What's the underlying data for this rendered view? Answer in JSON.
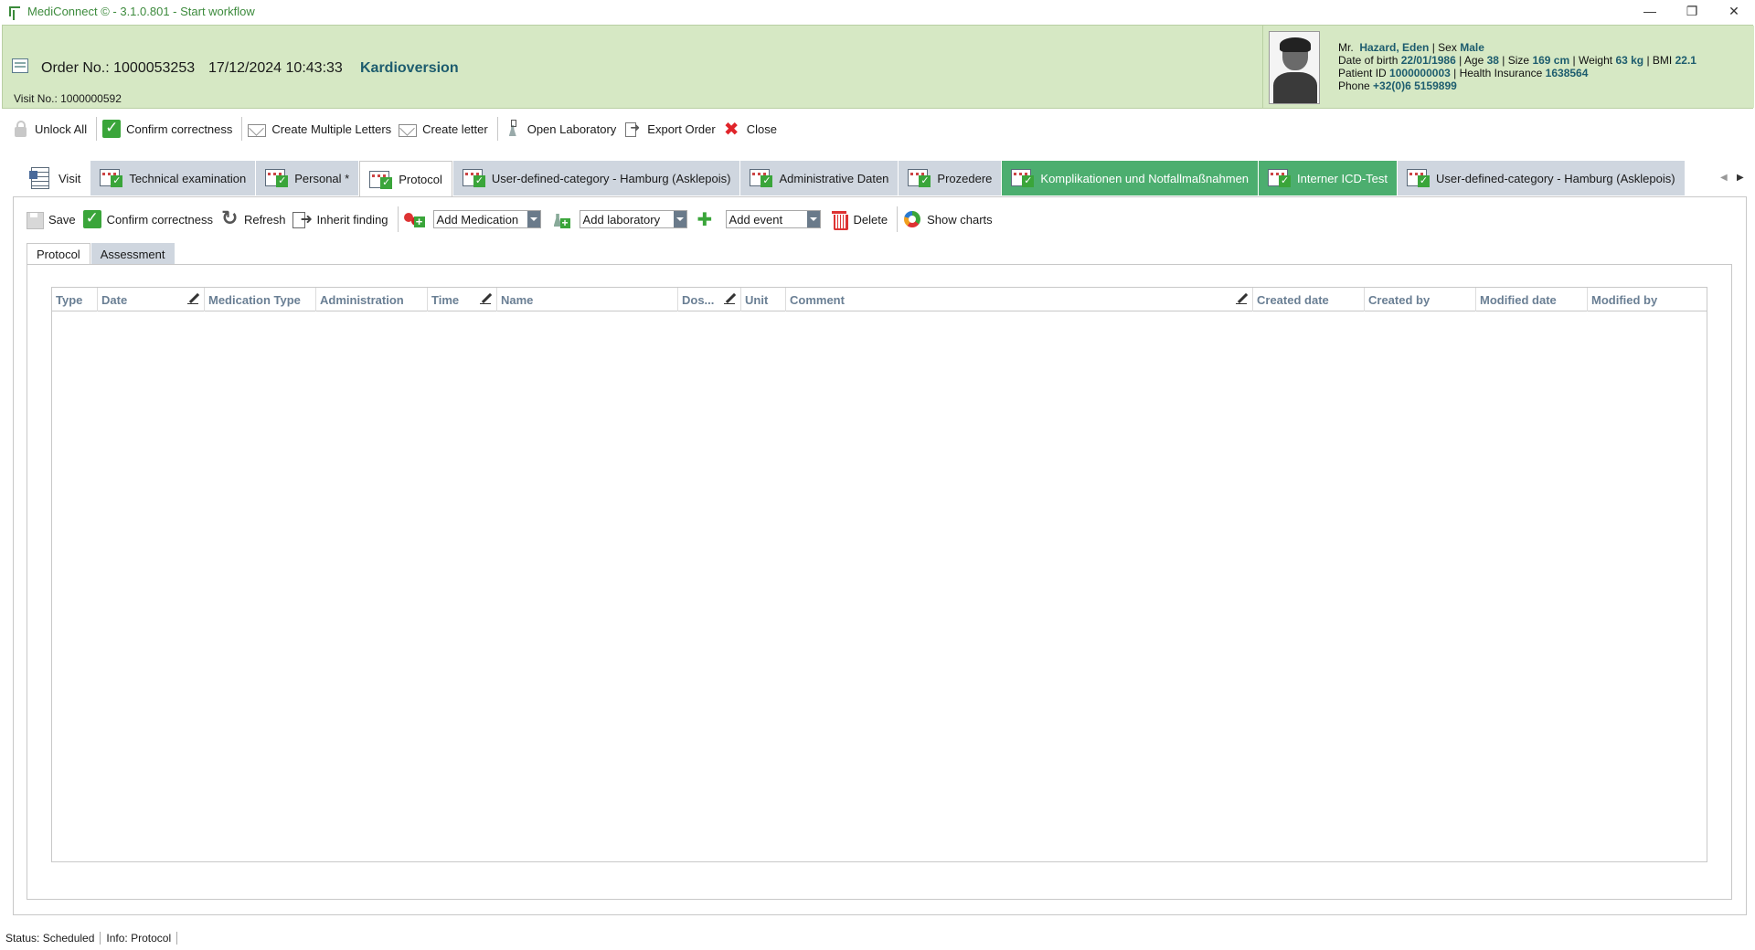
{
  "window": {
    "title": "MediConnect © - 3.1.0.801 - Start workflow",
    "controls": [
      "—",
      "❐",
      "✕"
    ]
  },
  "header": {
    "order_no": "Order No.: 1000053253",
    "order_datetime": "17/12/2024 10:43:33",
    "procedure": "Kardioversion",
    "visit_no": "Visit No.: 1000000592"
  },
  "patient": {
    "salutation": "Mr.",
    "name": "Hazard, Eden",
    "sex_label": "Sex",
    "sex": "Male",
    "dob_label": "Date of birth",
    "dob": "22/01/1986",
    "age_label": "Age",
    "age": "38",
    "size_label": "Size",
    "size": "169 cm",
    "weight_label": "Weight",
    "weight": "63 kg",
    "bmi_label": "BMI",
    "bmi": "22.1",
    "patient_id_label": "Patient ID",
    "patient_id": "1000000003",
    "insurance_label": "Health Insurance",
    "insurance": "1638564",
    "phone_label": "Phone",
    "phone": "+32(0)6 5159899"
  },
  "toolbar": {
    "unlock_all": "Unlock All",
    "confirm_correctness": "Confirm correctness",
    "create_multiple_letters": "Create Multiple Letters",
    "create_letter": "Create letter",
    "open_laboratory": "Open Laboratory",
    "export_order": "Export Order",
    "close": "Close"
  },
  "category_tabs": [
    {
      "label": "Visit",
      "state": "first"
    },
    {
      "label": "Technical examination",
      "state": "normal"
    },
    {
      "label": "Personal *",
      "state": "normal"
    },
    {
      "label": "Protocol",
      "state": "active"
    },
    {
      "label": "User-defined-category - Hamburg (Asklepois)",
      "state": "normal"
    },
    {
      "label": "Administrative Daten",
      "state": "normal"
    },
    {
      "label": "Prozedere",
      "state": "normal"
    },
    {
      "label": "Komplikationen und Notfallmaßnahmen",
      "state": "green"
    },
    {
      "label": "Interner ICD-Test",
      "state": "green"
    },
    {
      "label": "User-defined-category - Hamburg (Asklepois)",
      "state": "normal"
    }
  ],
  "sub_toolbar": {
    "save": "Save",
    "confirm_correctness": "Confirm correctness",
    "refresh": "Refresh",
    "inherit_finding": "Inherit finding",
    "add_medication": "Add Medication",
    "add_laboratory": "Add laboratory",
    "add_event": "Add event",
    "delete": "Delete",
    "show_charts": "Show charts"
  },
  "inner_tabs": {
    "protocol": "Protocol",
    "assessment": "Assessment"
  },
  "grid": {
    "columns": [
      {
        "label": "Type",
        "editable": false
      },
      {
        "label": "Date",
        "editable": true
      },
      {
        "label": "Medication Type",
        "editable": false
      },
      {
        "label": "Administration",
        "editable": false
      },
      {
        "label": "Time",
        "editable": true
      },
      {
        "label": "Name",
        "editable": false
      },
      {
        "label": "Dos...",
        "editable": true
      },
      {
        "label": "Unit",
        "editable": false
      },
      {
        "label": "Comment",
        "editable": true
      },
      {
        "label": "Created date",
        "editable": false
      },
      {
        "label": "Created by",
        "editable": false
      },
      {
        "label": "Modified date",
        "editable": false
      },
      {
        "label": "Modified by",
        "editable": false
      }
    ],
    "rows": []
  },
  "status": {
    "status": "Status: Scheduled",
    "info": "Info: Protocol"
  },
  "colors": {
    "header_bg": "#d6e8c4",
    "accent_teal": "#1d5c6e",
    "tab_green": "#4cae6f",
    "tab_grey": "#cfd6df"
  }
}
